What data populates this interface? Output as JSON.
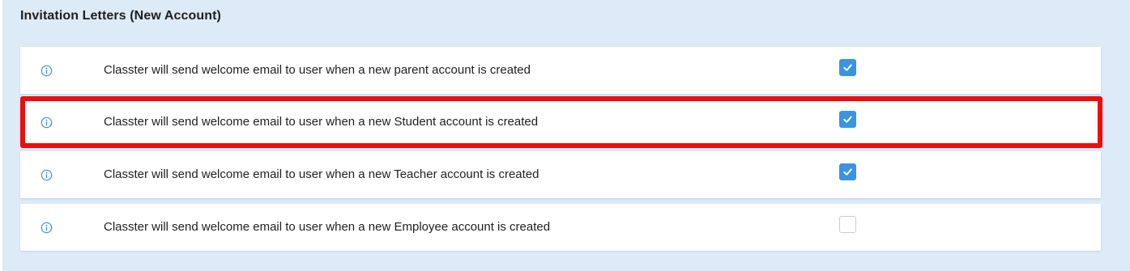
{
  "section": {
    "title": "Invitation Letters (New Account)"
  },
  "colors": {
    "background": "#ddeaf7",
    "accent": "#3a93e4",
    "highlight": "#ee0c0c"
  },
  "rows": [
    {
      "icon": "info-icon",
      "label": "Classter will send welcome email to user when a new parent account is created",
      "checked": true
    },
    {
      "icon": "info-icon",
      "label": "Classter will send welcome email to user when a new Student account is created",
      "checked": true,
      "highlighted": true
    },
    {
      "icon": "info-icon",
      "label": "Classter will send welcome email to user when a new Teacher account is created",
      "checked": true
    },
    {
      "icon": "info-icon",
      "label": "Classter will send welcome email to user when a new Employee account is created",
      "checked": false
    }
  ]
}
